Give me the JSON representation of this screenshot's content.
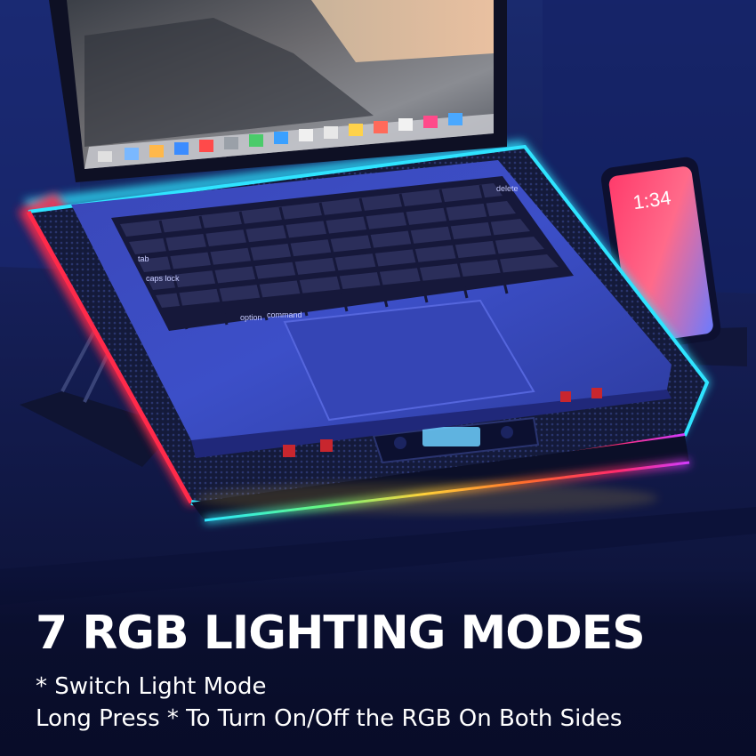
{
  "headline": "7 RGB LIGHTING MODES",
  "subtext": {
    "line1": "* Switch Light Mode",
    "line2": "Long Press * To Turn On/Off the RGB On Both Sides"
  },
  "phone": {
    "time": "1:34"
  },
  "keyboard": {
    "delete_key": "delete",
    "tab_key": "tab",
    "caps_key": "caps lock",
    "option_key": "option",
    "command_key": "command"
  },
  "icons": [
    "laptop-cooler-icon",
    "rgb-light-strip-icon",
    "phone-stand-icon",
    "fan-control-display-icon"
  ],
  "colors": {
    "background": "#0b1030",
    "rgb_red": "#ff2a4a",
    "rgb_cyan": "#2fe4ff",
    "rgb_yellow": "#ffd23a",
    "rgb_magenta": "#d23cff",
    "text": "#ffffff"
  }
}
